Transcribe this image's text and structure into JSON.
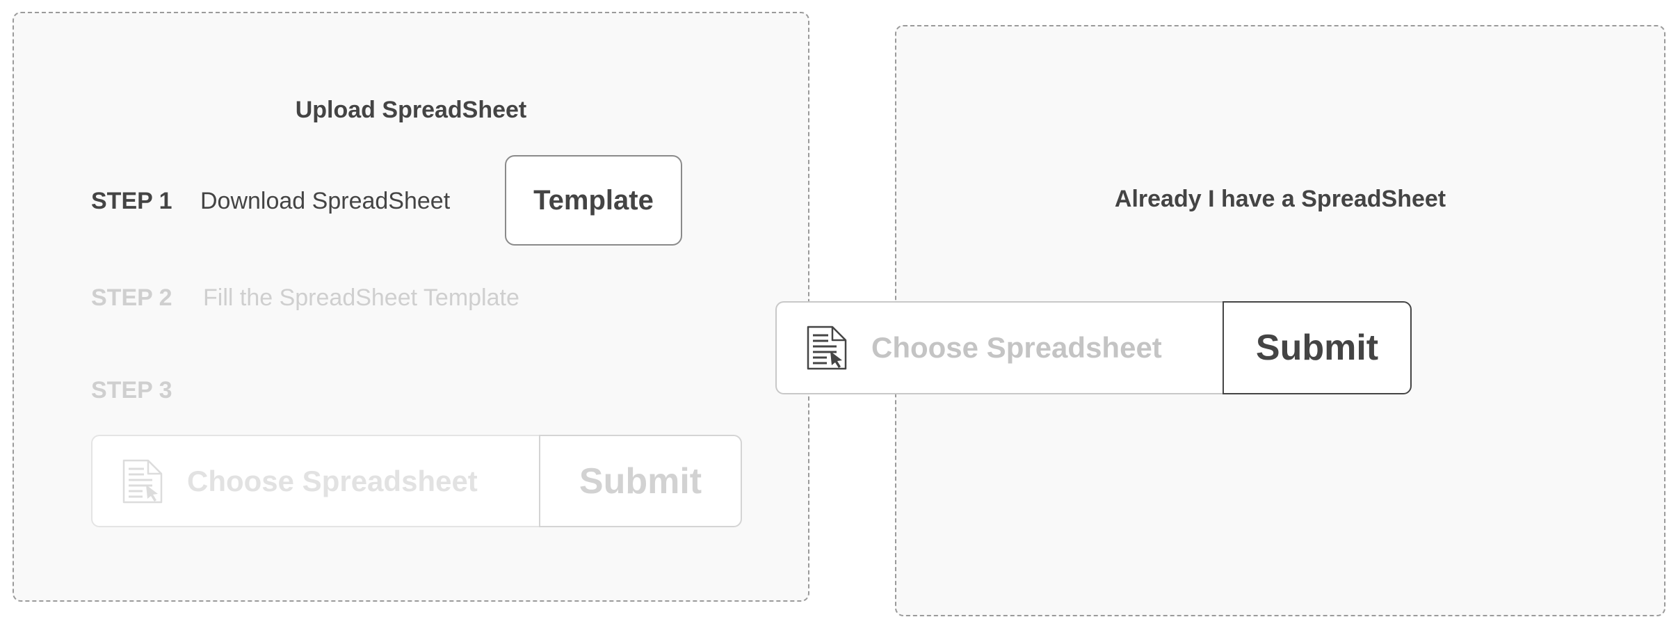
{
  "left_panel": {
    "title": "Upload SpreadSheet",
    "steps": [
      {
        "label": "STEP 1",
        "text": "Download SpreadSheet",
        "button": "Template"
      },
      {
        "label": "STEP 2",
        "text": "Fill the SpreadSheet Template"
      },
      {
        "label": "STEP 3"
      }
    ],
    "upload": {
      "placeholder": "Choose Spreadsheet",
      "submit_label": "Submit",
      "icon": "document-cursor-icon"
    }
  },
  "right_panel": {
    "title": "Already I have a SpreadSheet",
    "upload": {
      "placeholder": "Choose Spreadsheet",
      "submit_label": "Submit",
      "icon": "document-cursor-icon"
    }
  },
  "colors": {
    "panel_background": "#f9f9f9",
    "panel_border": "#9a9a9a",
    "text_active": "#444444",
    "text_muted": "#cfcfcf"
  }
}
